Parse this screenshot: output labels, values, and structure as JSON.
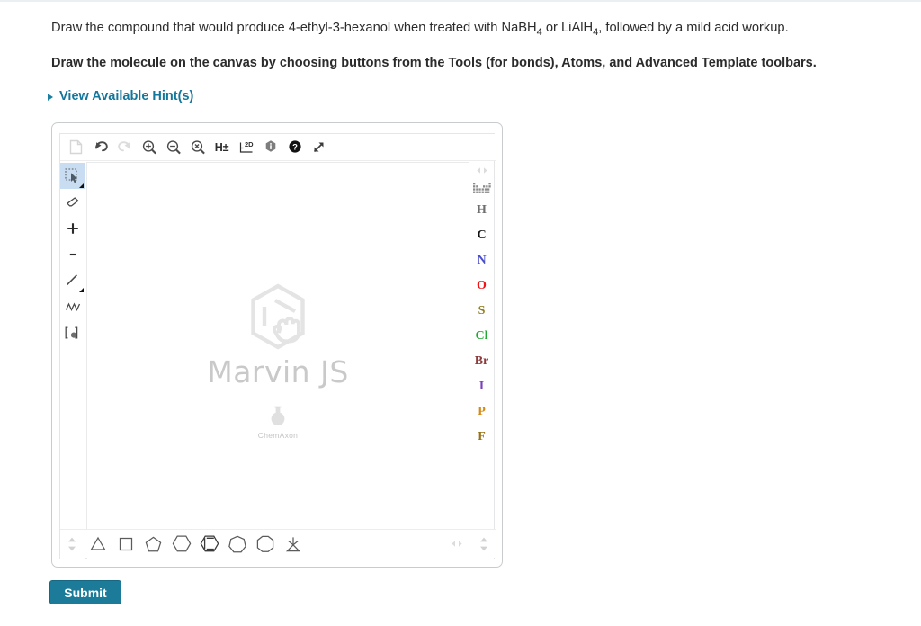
{
  "question": {
    "prompt_part1": "Draw the compound that would produce 4-ethyl-3-hexanol when treated with NaBH",
    "prompt_sub1": "4",
    "prompt_part2": " or LiAlH",
    "prompt_sub2": "4",
    "prompt_part3": ", followed by a mild acid workup.",
    "instruction": "Draw the molecule on the canvas by choosing buttons from the Tools (for bonds), Atoms, and Advanced Template toolbars."
  },
  "hint": {
    "label": "View Available Hint(s)",
    "caret_icon": "triangle-right-icon",
    "color": "#15769b"
  },
  "editor": {
    "top_toolbar": [
      {
        "name": "new-file-icon",
        "label": "",
        "disabled": true
      },
      {
        "name": "undo-icon",
        "label": "",
        "disabled": false
      },
      {
        "name": "redo-icon",
        "label": "",
        "disabled": true
      },
      {
        "name": "zoom-in-icon",
        "label": "",
        "disabled": false
      },
      {
        "name": "zoom-out-icon",
        "label": "",
        "disabled": false
      },
      {
        "name": "zoom-reset-icon",
        "label": "",
        "disabled": false
      },
      {
        "name": "hydrogen-toggle-icon",
        "label": "H±",
        "disabled": false
      },
      {
        "name": "clean-2d-icon",
        "label": "2D",
        "disabled": false
      },
      {
        "name": "info-icon",
        "label": "",
        "disabled": false
      },
      {
        "name": "help-icon",
        "label": "",
        "disabled": false
      },
      {
        "name": "fullscreen-icon",
        "label": "",
        "disabled": false
      }
    ],
    "tools": [
      {
        "name": "selection-tool-icon",
        "active": true
      },
      {
        "name": "eraser-tool-icon",
        "active": false
      },
      {
        "name": "increase-charge-tool-icon",
        "active": false
      },
      {
        "name": "decrease-charge-tool-icon",
        "active": false
      },
      {
        "name": "single-bond-tool-icon",
        "active": false
      },
      {
        "name": "chain-tool-icon",
        "active": false
      },
      {
        "name": "r-group-tool-icon",
        "active": false
      }
    ],
    "atoms": {
      "periodic_table_icon": "periodic-table-icon",
      "scroll_icon": "scroll-horizontal-icon",
      "items": [
        {
          "symbol": "H",
          "color": "#6f6f6f"
        },
        {
          "symbol": "C",
          "color": "#111111"
        },
        {
          "symbol": "N",
          "color": "#4a4ecb"
        },
        {
          "symbol": "O",
          "color": "#f01414"
        },
        {
          "symbol": "S",
          "color": "#8f7b1e"
        },
        {
          "symbol": "Cl",
          "color": "#20a830"
        },
        {
          "symbol": "Br",
          "color": "#8c3a3a"
        },
        {
          "symbol": "I",
          "color": "#7d3fbf"
        },
        {
          "symbol": "P",
          "color": "#d48a17"
        },
        {
          "symbol": "F",
          "color": "#967117"
        }
      ]
    },
    "templates": [
      {
        "name": "template-cyclopropane-icon",
        "sides": 3
      },
      {
        "name": "template-cyclobutane-icon",
        "sides": 4
      },
      {
        "name": "template-cyclopentane-icon",
        "sides": 5
      },
      {
        "name": "template-cyclohexane-icon",
        "sides": 6
      },
      {
        "name": "template-benzene-icon",
        "sides": 6
      },
      {
        "name": "template-cycloheptane-icon",
        "sides": 7
      },
      {
        "name": "template-cyclooctane-icon",
        "sides": 8
      },
      {
        "name": "template-stereocenter-icon",
        "sides": 0
      }
    ],
    "template_scroll_vertical_icon": "scroll-vertical-icon",
    "template_scroll_horizontal_icon": "scroll-horizontal-icon",
    "watermark": {
      "logo_icon": "marvin-hexagon-hand-icon",
      "name": "Marvin JS",
      "flask_icon": "flask-icon",
      "brand": "ChemAxon"
    }
  },
  "submit": {
    "label": "Submit",
    "color": "#1b7b99"
  }
}
